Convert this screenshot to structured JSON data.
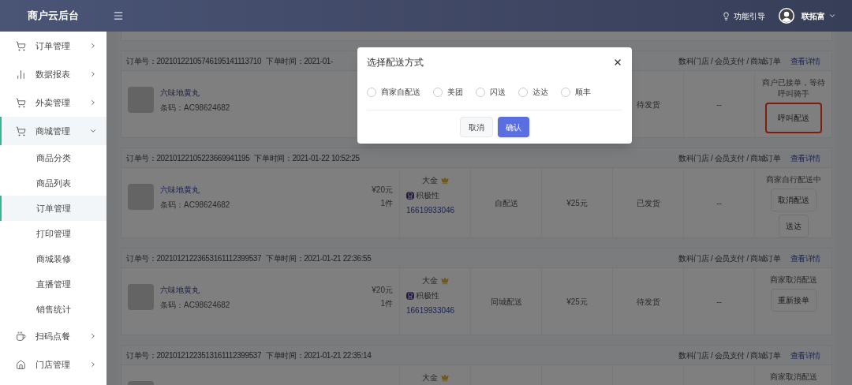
{
  "header": {
    "logo": "商户云后台",
    "guide": "功能引导",
    "user": "联拓富"
  },
  "sidebar": {
    "items": [
      {
        "label": "订单管理",
        "expanded": false
      },
      {
        "label": "数据报表",
        "expanded": false
      },
      {
        "label": "外卖管理",
        "expanded": false
      },
      {
        "label": "商城管理",
        "expanded": true,
        "children": [
          {
            "label": "商品分类",
            "selected": false
          },
          {
            "label": "商品列表",
            "selected": false
          },
          {
            "label": "订单管理",
            "selected": true
          },
          {
            "label": "打印管理",
            "selected": false
          },
          {
            "label": "商城装修",
            "selected": false
          },
          {
            "label": "直播管理",
            "selected": false
          },
          {
            "label": "销售统计",
            "selected": false
          }
        ]
      },
      {
        "label": "扫码点餐",
        "expanded": false
      },
      {
        "label": "门店管理",
        "expanded": false
      }
    ]
  },
  "orders": [
    {
      "order_no": "订单号：20210122105746195141113710",
      "time": "下单时间：2021-01-",
      "source": "数科门店 / 会员支付 / 商城订单",
      "detail_link": "查看详情",
      "product": {
        "name": "六味地黄丸",
        "barcode": "条码：AC98624682"
      },
      "status": "待发货",
      "extra": "--",
      "note": "商户已接单，等待呼叫骑手",
      "actions": [
        {
          "label": "呼叫配送",
          "highlighted": true
        }
      ]
    },
    {
      "order_no": "订单号：20210122105223669941195",
      "time": "下单时间：2021-01-22 10:52:25",
      "source": "数科门店 / 会员支付 / 商城订单",
      "detail_link": "查看详情",
      "product": {
        "name": "六味地黄丸",
        "barcode": "条码：AC98624682"
      },
      "price": "¥20元",
      "qty": "1件",
      "member": {
        "level": "大金",
        "tag": "积极性",
        "phone": "16619933046"
      },
      "delivery": "自配送",
      "fee": "¥25元",
      "status": "已发货",
      "extra": "--",
      "note": "商家自行配送中",
      "actions": [
        {
          "label": "取消配送",
          "highlighted": false
        },
        {
          "label": "送达",
          "highlighted": false
        }
      ]
    },
    {
      "order_no": "订单号：20210121223653161112399537",
      "time": "下单时间：2021-01-21 22:36:55",
      "source": "数科门店 / 会员支付 / 商城订单",
      "detail_link": "查看详情",
      "product": {
        "name": "六味地黄丸",
        "barcode": "条码：AC98624682"
      },
      "price": "¥20元",
      "qty": "1件",
      "member": {
        "level": "大金",
        "tag": "积极性",
        "phone": "16619933046"
      },
      "delivery": "同城配送",
      "fee": "¥25元",
      "status": "待发货",
      "extra": "--",
      "note": "商家取消配送",
      "actions": [
        {
          "label": "重新接单",
          "highlighted": false
        }
      ]
    },
    {
      "order_no": "订单号：20210121223513161112399537",
      "time": "下单时间：2021-01-21 22:35:14",
      "source": "数科门店 / 会员支付 / 商城订单",
      "detail_link": "查看详情",
      "member": {
        "level": "大金"
      },
      "note": "商家取消配送"
    }
  ],
  "modal": {
    "title": "选择配送方式",
    "options": [
      {
        "label": "商家自配送",
        "selected": false
      },
      {
        "label": "美团",
        "selected": false
      },
      {
        "label": "闪送",
        "selected": false
      },
      {
        "label": "达达",
        "selected": false
      },
      {
        "label": "顺丰",
        "selected": false
      }
    ],
    "buttons": [
      {
        "label": "取消",
        "kind": "secondary"
      },
      {
        "label": "确认",
        "kind": "primary"
      }
    ]
  }
}
